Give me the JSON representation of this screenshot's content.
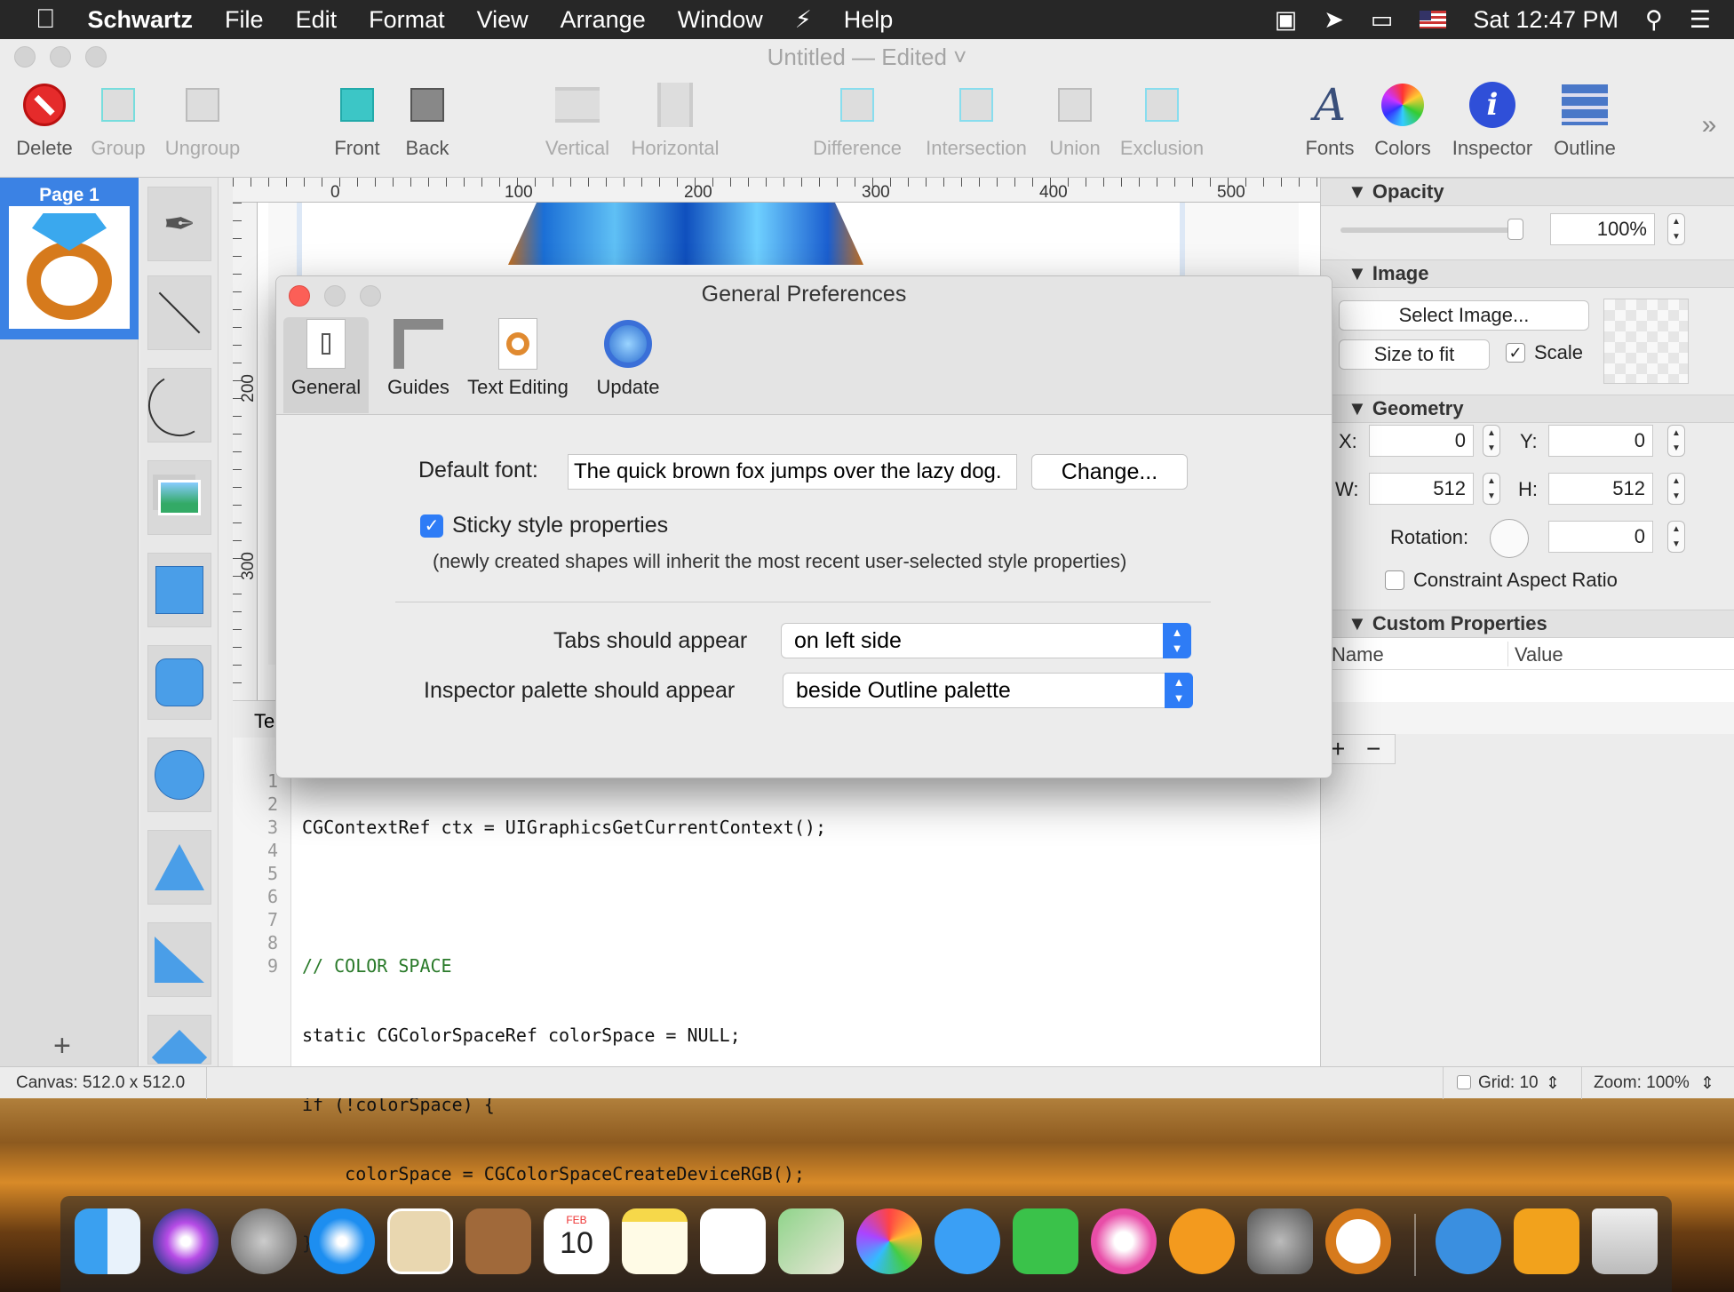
{
  "menubar": {
    "app": "Schwartz",
    "items": [
      "File",
      "Edit",
      "Format",
      "View",
      "Arrange",
      "Window",
      "Help"
    ],
    "clock": "Sat 12:47 PM"
  },
  "window": {
    "title": "Untitled — Edited ˅"
  },
  "toolbar": {
    "delete": "Delete",
    "group": "Group",
    "ungroup": "Ungroup",
    "front": "Front",
    "back": "Back",
    "vertical": "Vertical",
    "horizontal": "Horizontal",
    "difference": "Difference",
    "intersection": "Intersection",
    "union": "Union",
    "exclusion": "Exclusion",
    "fonts": "Fonts",
    "colors": "Colors",
    "inspector": "Inspector",
    "outline": "Outline",
    "overflow": "»"
  },
  "pages": {
    "page1": "Page 1",
    "add": "+"
  },
  "ruler": {
    "h_labels": [
      "0",
      "100",
      "200",
      "300",
      "400",
      "500"
    ],
    "v_labels": [
      "200",
      "300"
    ]
  },
  "code": {
    "tab_label": "Te",
    "line_numbers": [
      "1",
      "2",
      "3",
      "4",
      "5",
      "6",
      "7",
      "8",
      "9"
    ],
    "lines": [
      "CGContextRef ctx = UIGraphicsGetCurrentContext();",
      "",
      "// COLOR SPACE",
      "static CGColorSpaceRef colorSpace = NULL;",
      "if (!colorSpace) {",
      "    colorSpace = CGColorSpaceCreateDeviceRGB();",
      "}",
      "",
      ""
    ]
  },
  "inspector": {
    "opacity_title": "Opacity",
    "opacity_value": "100%",
    "opacity_level": 1.0,
    "image_title": "Image",
    "select_image": "Select Image...",
    "size_to_fit": "Size to fit",
    "scale_label": "Scale",
    "scale_checked": true,
    "geometry_title": "Geometry",
    "x_label": "X:",
    "x_value": "0",
    "y_label": "Y:",
    "y_value": "0",
    "w_label": "W:",
    "w_value": "512",
    "h_label": "H:",
    "h_value": "512",
    "rotation_label": "Rotation:",
    "rotation_value": "0",
    "constraint_label": "Constraint Aspect Ratio",
    "custom_title": "Custom Properties",
    "col_name": "Name",
    "col_value": "Value",
    "add": "+",
    "remove": "−"
  },
  "status": {
    "canvas": "Canvas: 512.0 x 512.0",
    "grid": "Grid: 10",
    "zoom": "Zoom:  100%"
  },
  "dialog": {
    "title": "General Preferences",
    "tabs": [
      "General",
      "Guides",
      "Text Editing",
      "Update"
    ],
    "default_font_label": "Default font:",
    "default_font_value": "The quick brown fox jumps over the lazy dog.",
    "change_button": "Change...",
    "sticky_label": "Sticky style properties",
    "sticky_checked": true,
    "sticky_note": "(newly created shapes will inherit the most recent user-selected style properties)",
    "tabs_label": "Tabs should appear",
    "tabs_value": "on left side",
    "inspector_label": "Inspector palette should appear",
    "inspector_value": "beside Outline palette"
  },
  "dock": {
    "calendar_month": "FEB",
    "calendar_day": "10"
  },
  "colors": {
    "accent": "#2e7cf6",
    "selection": "#3b82e4",
    "menubar": "#272727"
  }
}
